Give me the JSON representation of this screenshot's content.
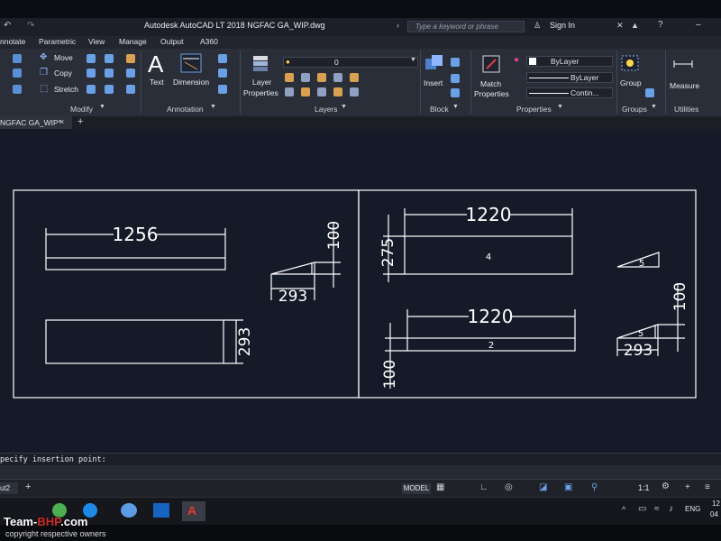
{
  "titlebar": {
    "title": "Autodesk AutoCAD LT 2018    NGFAC GA_WIP.dwg",
    "search_placeholder": "Type a keyword or phrase",
    "sign_in": "Sign In"
  },
  "ribbon_tabs": [
    "nnotate",
    "Parametric",
    "View",
    "Manage",
    "Output",
    "A360"
  ],
  "ribbon": {
    "modify": {
      "move": "Move",
      "copy": "Copy",
      "stretch": "Stretch",
      "label": "Modify"
    },
    "annotation": {
      "text": "Text",
      "dimension": "Dimension",
      "label": "Annotation"
    },
    "layers": {
      "layer_properties_1": "Layer",
      "layer_properties_2": "Properties",
      "current_layer": "0",
      "label": "Layers"
    },
    "block": {
      "insert": "Insert",
      "label": "Block"
    },
    "properties": {
      "match_1": "Match",
      "match_2": "Properties",
      "color": "ByLayer",
      "lineweight": "ByLayer",
      "linetype": "Contin...",
      "label": "Properties"
    },
    "groups": {
      "group": "Group",
      "label": "Groups"
    },
    "utilities": {
      "measure": "Measure",
      "label": "Utilities"
    }
  },
  "file_tab": "NGFAC GA_WIP*",
  "drawing": {
    "left_top_width": "1256",
    "left_top_height": "100",
    "left_wedge_width": "293",
    "left_bottom_height": "293",
    "right_top_width": "1220",
    "right_top_height": "275",
    "right_top_label": "4",
    "right_wedge_top_label": "5",
    "right_bottom_width": "1220",
    "right_bottom_label": "2",
    "right_bottom_height": "100",
    "right_wedge_height": "100",
    "right_wedge_bottom_label": "5",
    "right_wedge_width": "293"
  },
  "command_line": "pecify insertion point:",
  "status": {
    "layout_tab": "ut2",
    "model": "MODEL",
    "scale": "1:1"
  },
  "taskbar": {
    "language": "ENG",
    "clock_1": "12",
    "clock_2": "04"
  },
  "watermark": {
    "team": "Team-",
    "bhp": "BHP",
    "com": ".com",
    "copyright": "copyright respective owners"
  }
}
